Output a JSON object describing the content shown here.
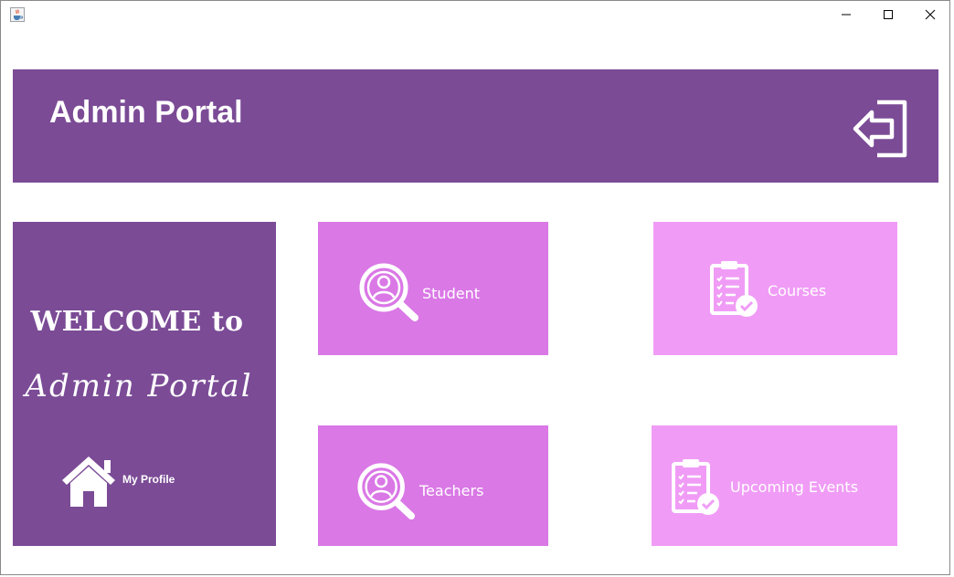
{
  "window": {
    "icons": {
      "app": "java-cup-icon",
      "minimize": "minimize-icon",
      "maximize": "maximize-icon",
      "close": "close-icon"
    }
  },
  "header": {
    "title": "Admin Portal",
    "logout_icon": "logout-icon",
    "color": "#7b4b96"
  },
  "welcome": {
    "line1": "WELCOME to",
    "line2": "Admin Portal",
    "profile_label": "My Profile",
    "profile_icon": "home-icon",
    "color": "#7b4b96"
  },
  "tiles": [
    {
      "label": "Student",
      "icon": "search-user-icon",
      "color": "#da78e6"
    },
    {
      "label": "Courses",
      "icon": "clipboard-check-icon",
      "color": "#f09cf6"
    },
    {
      "label": "Teachers",
      "icon": "search-user-icon",
      "color": "#da78e6"
    },
    {
      "label": "Upcoming Events",
      "icon": "clipboard-check-icon",
      "color": "#f09cf6"
    }
  ]
}
